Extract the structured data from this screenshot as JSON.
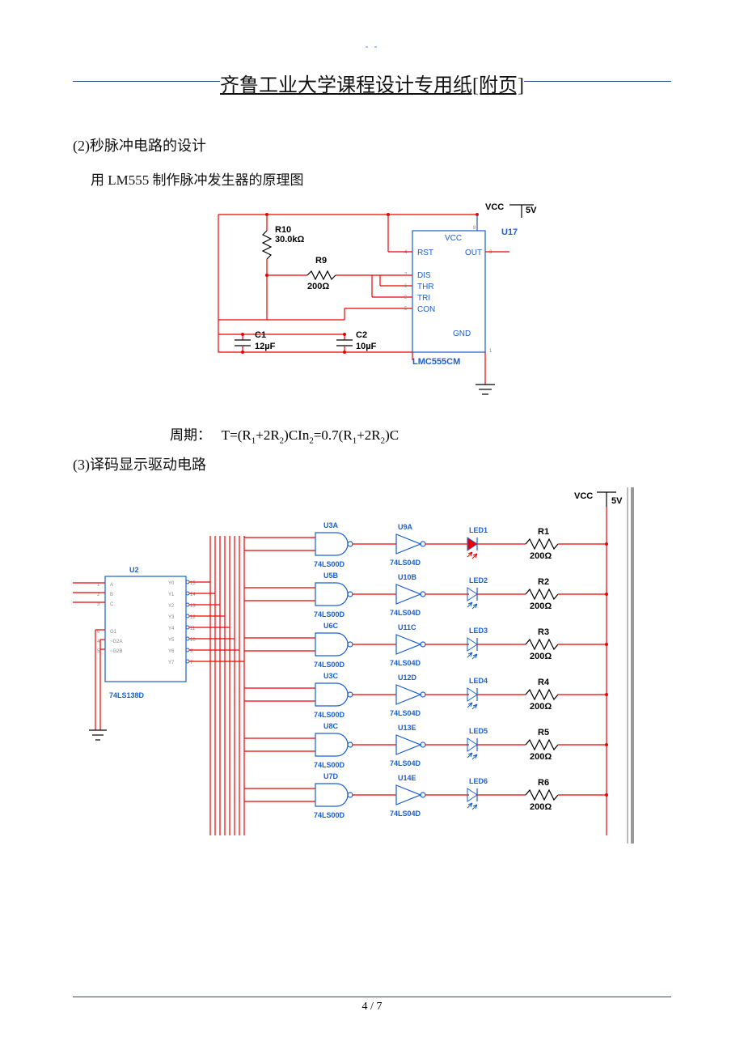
{
  "dash_mark": "- -",
  "page_title": "齐鲁工业大学课程设计专用纸[附页]",
  "section2": {
    "heading": "(2)秒脉冲电路的设计",
    "sub": "用 LM555 制作脉冲发生器的原理图"
  },
  "formula": {
    "label": "周期：",
    "tpre": "T=(R",
    "s1": "1",
    "mid1": "+2R",
    "s2": "2",
    "mid2": ")CIn",
    "s3": "2",
    "mid3": "=0.7(R",
    "s4": "1",
    "mid4": "+2R",
    "s5": "2",
    "mid5": ")C"
  },
  "section3": {
    "heading": "(3)译码显示驱动电路"
  },
  "schem1": {
    "vcc": "VCC",
    "v5": "5V",
    "r10": "R10",
    "r10v": "30.0kΩ",
    "r9": "R9",
    "r9v": "200Ω",
    "c1": "C1",
    "c1v": "12µF",
    "c2": "C2",
    "c2v": "10µF",
    "u17": "U17",
    "chip": "LMC555CM",
    "pins": {
      "rst": "RST",
      "out": "OUT",
      "dis": "DIS",
      "thr": "THR",
      "tri": "TRI",
      "con": "CON",
      "gnd": "GND",
      "vcc": "VCC"
    },
    "pnum": {
      "p8": "8",
      "p4": "4",
      "p7": "7",
      "p6": "6",
      "p2": "2",
      "p5": "5",
      "p3": "3",
      "p1": "1"
    }
  },
  "schem2": {
    "vcc": "VCC",
    "v5": "5V",
    "decoder": {
      "ref": "U2",
      "part": "74LS138D",
      "inL": {
        "A": "A",
        "B": "B",
        "C": "C",
        "G1": "G1",
        "G2A": "~G2A",
        "G2B": "~G2B"
      },
      "inN": {
        "A": "1",
        "B": "2",
        "C": "3",
        "G1": "6",
        "G2A": "4",
        "G2B": "5"
      },
      "outL": {
        "Y0": "Y0",
        "Y1": "Y1",
        "Y2": "Y2",
        "Y3": "Y3",
        "Y4": "Y4",
        "Y5": "Y5",
        "Y6": "Y6",
        "Y7": "Y7"
      },
      "outN": {
        "Y0": "15",
        "Y1": "14",
        "Y2": "13",
        "Y3": "12",
        "Y4": "11",
        "Y5": "10",
        "Y6": "9",
        "Y7": "7"
      }
    },
    "nand_refs": [
      "U3A",
      "U5B",
      "U6C",
      "U3C",
      "U8C",
      "U7D"
    ],
    "nand_part": "74LS00D",
    "inv_refs": [
      "U9A",
      "U10B",
      "U11C",
      "U12D",
      "U13E",
      "U14E"
    ],
    "inv_part": "74LS04D",
    "leds": [
      "LED1",
      "LED2",
      "LED3",
      "LED4",
      "LED5",
      "LED6"
    ],
    "res_refs": [
      "R1",
      "R2",
      "R3",
      "R4",
      "R5",
      "R6"
    ],
    "res_val": "200Ω"
  },
  "pager": {
    "cur": "4",
    "sep": " / ",
    "total": "7"
  }
}
